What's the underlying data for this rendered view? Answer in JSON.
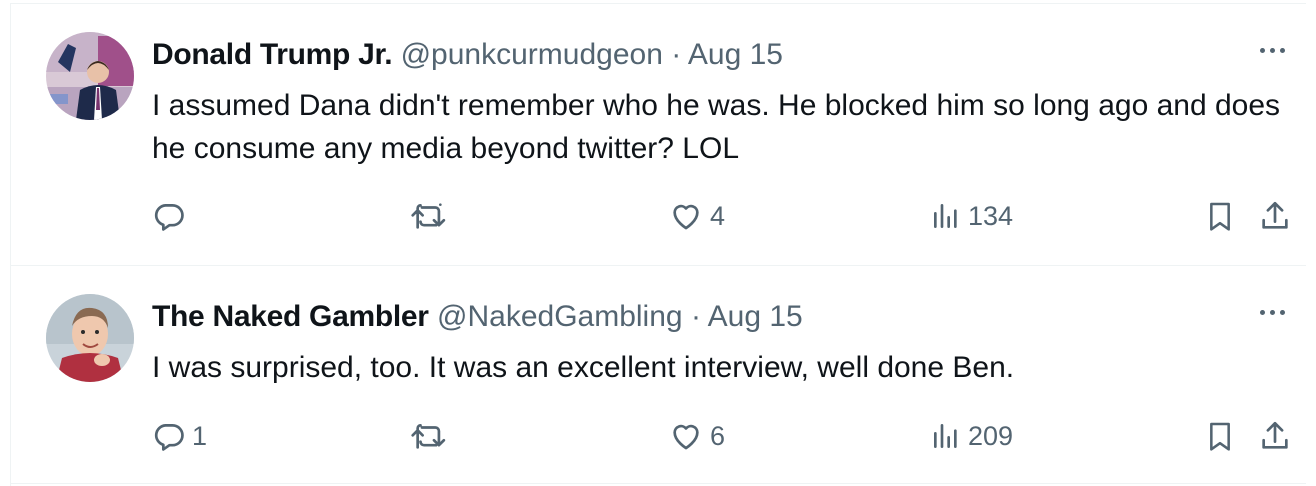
{
  "tweets": [
    {
      "author_name": "Donald Trump Jr.",
      "handle": "@punkcurmudgeon",
      "separator": "·",
      "date": "Aug 15",
      "text": "I assumed Dana didn't remember who he was. He blocked him so long ago and does he consume any media beyond twitter? LOL",
      "reply_count": "",
      "repost_count": "",
      "like_count": "4",
      "view_count": "134"
    },
    {
      "author_name": "The Naked Gambler",
      "handle": "@NakedGambling",
      "separator": "·",
      "date": "Aug 15",
      "text": "I was surprised, too. It was an excellent interview, well done Ben.",
      "reply_count": "1",
      "repost_count": "",
      "like_count": "6",
      "view_count": "209"
    }
  ],
  "icons": {
    "reply": "reply-icon",
    "repost": "repost-icon",
    "like": "heart-icon",
    "views": "views-icon",
    "bookmark": "bookmark-icon",
    "share": "share-icon",
    "more": "more-icon"
  },
  "colors": {
    "text": "#0f1419",
    "secondary": "#536471",
    "border": "#eff3f4"
  }
}
